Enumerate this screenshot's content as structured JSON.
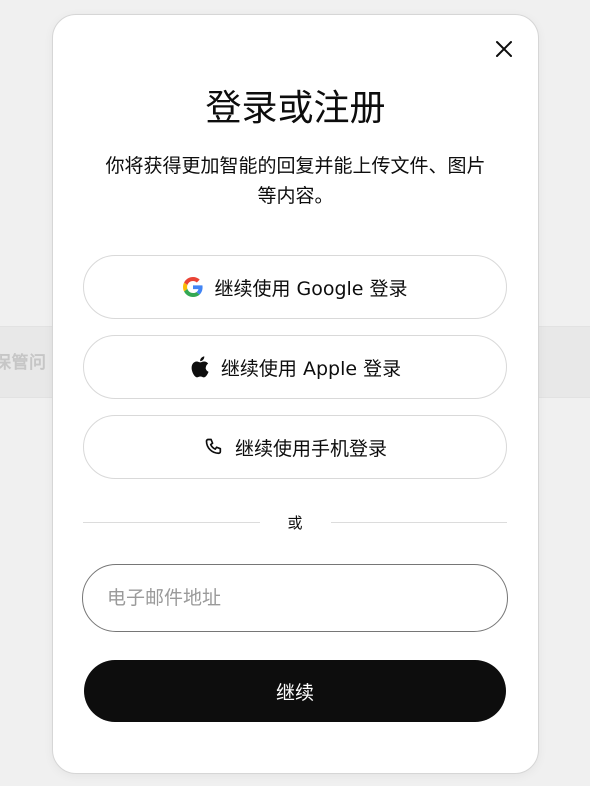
{
  "background": {
    "partial_text": "保管问"
  },
  "modal": {
    "title": "登录或注册",
    "subtitle": "你将获得更加智能的回复并能上传文件、图片等内容。",
    "close_icon": "close-icon",
    "buttons": [
      {
        "id": "google",
        "label": "继续使用 Google 登录",
        "icon": "google-icon"
      },
      {
        "id": "apple",
        "label": "继续使用 Apple 登录",
        "icon": "apple-icon"
      },
      {
        "id": "phone",
        "label": "继续使用手机登录",
        "icon": "phone-icon"
      }
    ],
    "divider_text": "或",
    "email": {
      "placeholder": "电子邮件地址",
      "value": ""
    },
    "continue_label": "继续"
  },
  "colors": {
    "primary": "#0d0d0d",
    "google_blue": "#4285F4",
    "google_red": "#EA4335",
    "google_yellow": "#FBBC05",
    "google_green": "#34A853"
  }
}
